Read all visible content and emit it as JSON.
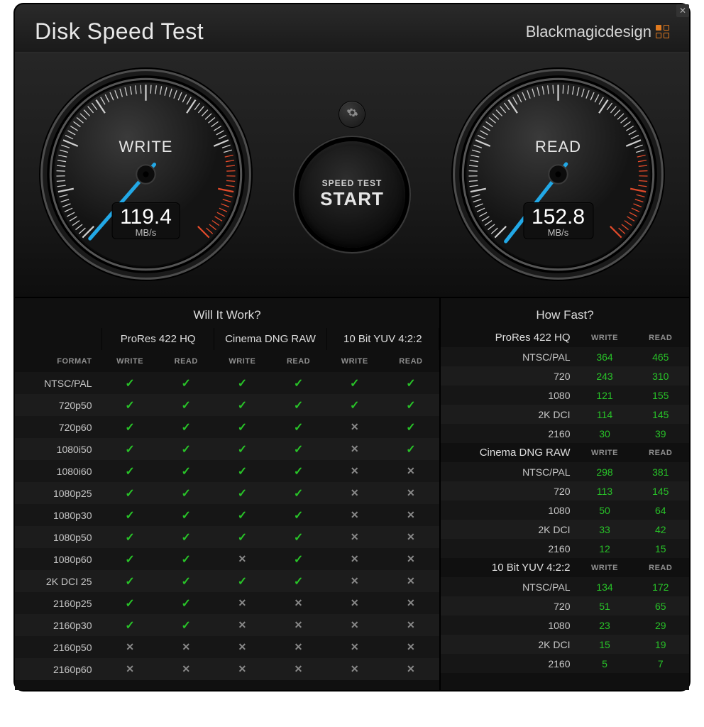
{
  "app_title": "Disk Speed Test",
  "brand": "Blackmagicdesign",
  "gauges": {
    "write": {
      "label": "WRITE",
      "value": "119.4",
      "unit": "MB/s",
      "needle_angle": -120
    },
    "read": {
      "label": "READ",
      "value": "152.8",
      "unit": "MB/s",
      "needle_angle": -114
    }
  },
  "start_button": {
    "top": "SPEED TEST",
    "main": "START"
  },
  "left_table": {
    "title": "Will It Work?",
    "format_header": "FORMAT",
    "groups": [
      "ProRes 422 HQ",
      "Cinema DNG RAW",
      "10 Bit YUV 4:2:2"
    ],
    "subcols": [
      "WRITE",
      "READ"
    ],
    "rows": [
      {
        "fmt": "NTSC/PAL",
        "cells": [
          1,
          1,
          1,
          1,
          1,
          1
        ]
      },
      {
        "fmt": "720p50",
        "cells": [
          1,
          1,
          1,
          1,
          1,
          1
        ]
      },
      {
        "fmt": "720p60",
        "cells": [
          1,
          1,
          1,
          1,
          0,
          1
        ]
      },
      {
        "fmt": "1080i50",
        "cells": [
          1,
          1,
          1,
          1,
          0,
          1
        ]
      },
      {
        "fmt": "1080i60",
        "cells": [
          1,
          1,
          1,
          1,
          0,
          0
        ]
      },
      {
        "fmt": "1080p25",
        "cells": [
          1,
          1,
          1,
          1,
          0,
          0
        ]
      },
      {
        "fmt": "1080p30",
        "cells": [
          1,
          1,
          1,
          1,
          0,
          0
        ]
      },
      {
        "fmt": "1080p50",
        "cells": [
          1,
          1,
          1,
          1,
          0,
          0
        ]
      },
      {
        "fmt": "1080p60",
        "cells": [
          1,
          1,
          0,
          1,
          0,
          0
        ]
      },
      {
        "fmt": "2K DCI 25",
        "cells": [
          1,
          1,
          1,
          1,
          0,
          0
        ]
      },
      {
        "fmt": "2160p25",
        "cells": [
          1,
          1,
          0,
          0,
          0,
          0
        ]
      },
      {
        "fmt": "2160p30",
        "cells": [
          1,
          1,
          0,
          0,
          0,
          0
        ]
      },
      {
        "fmt": "2160p50",
        "cells": [
          0,
          0,
          0,
          0,
          0,
          0
        ]
      },
      {
        "fmt": "2160p60",
        "cells": [
          0,
          0,
          0,
          0,
          0,
          0
        ]
      }
    ]
  },
  "right_table": {
    "title": "How Fast?",
    "subcols": [
      "WRITE",
      "READ"
    ],
    "sections": [
      {
        "name": "ProRes 422 HQ",
        "rows": [
          {
            "fmt": "NTSC/PAL",
            "w": "364",
            "r": "465"
          },
          {
            "fmt": "720",
            "w": "243",
            "r": "310"
          },
          {
            "fmt": "1080",
            "w": "121",
            "r": "155"
          },
          {
            "fmt": "2K DCI",
            "w": "114",
            "r": "145"
          },
          {
            "fmt": "2160",
            "w": "30",
            "r": "39"
          }
        ]
      },
      {
        "name": "Cinema DNG RAW",
        "rows": [
          {
            "fmt": "NTSC/PAL",
            "w": "298",
            "r": "381"
          },
          {
            "fmt": "720",
            "w": "113",
            "r": "145"
          },
          {
            "fmt": "1080",
            "w": "50",
            "r": "64"
          },
          {
            "fmt": "2K DCI",
            "w": "33",
            "r": "42"
          },
          {
            "fmt": "2160",
            "w": "12",
            "r": "15"
          }
        ]
      },
      {
        "name": "10 Bit YUV 4:2:2",
        "rows": [
          {
            "fmt": "NTSC/PAL",
            "w": "134",
            "r": "172"
          },
          {
            "fmt": "720",
            "w": "51",
            "r": "65"
          },
          {
            "fmt": "1080",
            "w": "23",
            "r": "29"
          },
          {
            "fmt": "2K DCI",
            "w": "15",
            "r": "19"
          },
          {
            "fmt": "2160",
            "w": "5",
            "r": "7"
          }
        ]
      }
    ]
  }
}
